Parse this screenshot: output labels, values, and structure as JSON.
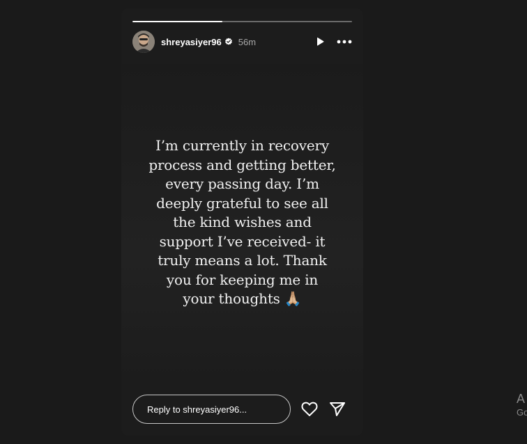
{
  "story": {
    "progress": 0.41,
    "user": {
      "username": "shreyasiyer96",
      "verified": true,
      "time_ago": "56m",
      "avatar_icon": "avatar-photo"
    },
    "header_icons": {
      "play": "play-icon",
      "more": "more-icon"
    },
    "text_lines": [
      "I’m currently in recovery",
      "process and getting better,",
      "every passing day. I’m",
      "deeply grateful to see all",
      "the kind wishes and",
      "support I’ve received- it",
      "truly means a lot. Thank",
      "you for keeping me in",
      "your thoughts 🙏🏼"
    ],
    "reply": {
      "placeholder": "Reply to shreyasiyer96..."
    },
    "reply_icons": {
      "like": "heart-icon",
      "share": "send-icon"
    }
  },
  "side_text": {
    "line1": "A",
    "line2": "Go"
  },
  "colors": {
    "page_background": "#1a1a1a",
    "story_background": "#1c1c1c",
    "text": "#f2f2f2",
    "muted": "#a8a8a8"
  }
}
